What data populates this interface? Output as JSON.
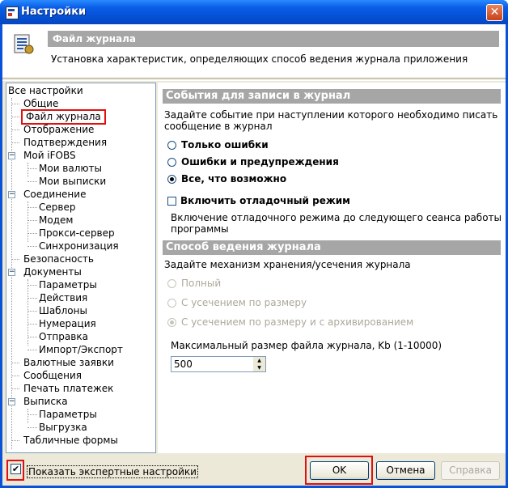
{
  "window": {
    "title": "Настройки",
    "close_icon": "close-icon"
  },
  "header": {
    "title": "Файл журнала",
    "subtitle": "Установка характеристик, определяющих способ ведения журнала приложения",
    "icon": "settings-list-icon"
  },
  "tree": {
    "root": "Все настройки",
    "items": [
      "Общие",
      "Файл журнала",
      "Отображение",
      "Подтверждения",
      "Мой iFOBS",
      "Мои валюты",
      "Мои выписки",
      "Соединение",
      "Сервер",
      "Модем",
      "Прокси-сервер",
      "Синхронизация",
      "Безопасность",
      "Документы",
      "Параметры",
      "Действия",
      "Шаблоны",
      "Нумерация",
      "Отправка",
      "Импорт/Экспорт",
      "Валютные заявки",
      "Сообщения",
      "Печать платежек",
      "Выписка",
      "Параметры",
      "Выгрузка",
      "Табличные формы"
    ],
    "selected": "Файл журнала"
  },
  "events": {
    "heading": "События для записи в журнал",
    "desc1": "Задайте событие при наступлении которого необходимо писать",
    "desc2": "сообщение в журнал",
    "options": [
      "Только ошибки",
      "Ошибки и предупреждения",
      "Все, что возможно"
    ],
    "selected_index": 2,
    "debug_label": "Включить отладочный режим",
    "debug_checked": false,
    "debug_desc1": "Включение отладочного режима до следующего сеанса работы",
    "debug_desc2": "программы"
  },
  "logging": {
    "heading": "Способ ведения журнала",
    "desc": "Задайте механизм хранения/усечения журнала",
    "options": [
      "Полный",
      "С усечением по размеру",
      "С усечением по размеру и с архивированием"
    ],
    "selected_index": 2,
    "max_size_label": "Максимальный размер файла журнала, Kb (1-10000)",
    "max_size_value": "500"
  },
  "footer": {
    "expert_label": "Показать экспертные настройки",
    "expert_checked": true,
    "ok": "OK",
    "cancel": "Отмена",
    "help": "Справка"
  }
}
